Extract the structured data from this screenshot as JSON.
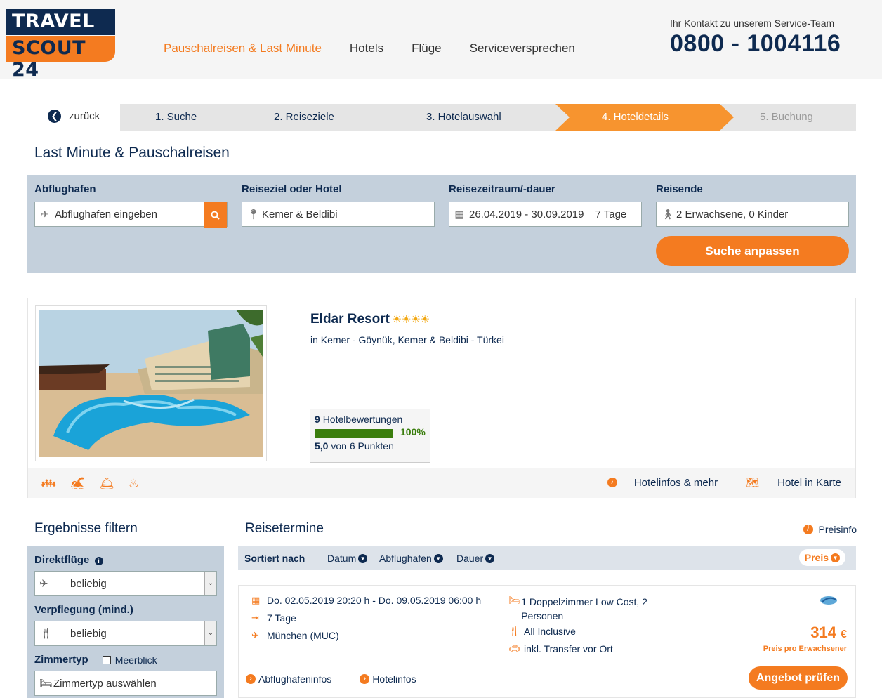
{
  "logo": {
    "line1": "TRAVEL",
    "line2": "SCOUT 24"
  },
  "nav": [
    "Pauschalreisen & Last Minute",
    "Hotels",
    "Flüge",
    "Serviceversprechen"
  ],
  "contact": {
    "label": "Ihr Kontakt zu unserem Service-Team",
    "phone": "0800 - 1004116"
  },
  "steps": {
    "back": "zurück",
    "items": [
      "1. Suche",
      "2. Reiseziele",
      "3. Hotelauswahl",
      "4. Hoteldetails",
      "5. Buchung"
    ]
  },
  "page_title": "Last Minute & Pauschalreisen",
  "search": {
    "departure_label": "Abflughafen",
    "departure_placeholder": "Abflughafen eingeben",
    "destination_label": "Reiseziel oder Hotel",
    "destination_value": "Kemer & Beldibi",
    "period_label": "Reisezeitraum/-dauer",
    "period_value": "26.04.2019 - 30.09.2019",
    "duration_value": "7 Tage",
    "travelers_label": "Reisende",
    "travelers_value": "2 Erwachsene, 0 Kinder",
    "submit": "Suche anpassen"
  },
  "hotel": {
    "name": "Eldar Resort",
    "stars": "☀☀☀☀",
    "location": "in Kemer - Göynük, Kemer & Beldibi - Türkei",
    "reviews_count": "9",
    "reviews_label": "Hotelbewertungen",
    "recommend_pct": "100%",
    "score": "5,0",
    "score_label": "von 6 Punkten",
    "info_link": "Hotelinfos & mehr",
    "map_link": "Hotel in Karte"
  },
  "filter": {
    "title": "Ergebnisse filtern",
    "direct_label": "Direktflüge",
    "direct_value": "beliebig",
    "board_label": "Verpflegung (mind.)",
    "board_value": "beliebig",
    "room_label": "Zimmertyp",
    "seaview": "Meerblick",
    "room_placeholder": "Zimmertyp auswählen"
  },
  "results": {
    "title": "Reisetermine",
    "price_info": "Preisinfo",
    "sort_label": "Sortiert nach",
    "sort": [
      "Datum",
      "Abflughafen",
      "Dauer"
    ],
    "sort_active": "Preis"
  },
  "offer": {
    "dates": "Do. 02.05.2019 20:20 h - Do. 09.05.2019 06:00 h",
    "duration": "7 Tage",
    "airport": "München (MUC)",
    "room": "1 Doppelzimmer Low Cost, 2 Personen",
    "board": "All Inclusive",
    "transfer": "inkl. Transfer vor Ort",
    "price": "314",
    "currency": "€",
    "price_note": "Preis pro Erwachsener",
    "airport_info": "Abflughafeninfos",
    "hotel_info": "Hotelinfos",
    "cta": "Angebot prüfen"
  },
  "colors": {
    "brand_orange": "#f47b20",
    "brand_navy": "#0e2a50",
    "rating_green": "#3a7d0d"
  }
}
